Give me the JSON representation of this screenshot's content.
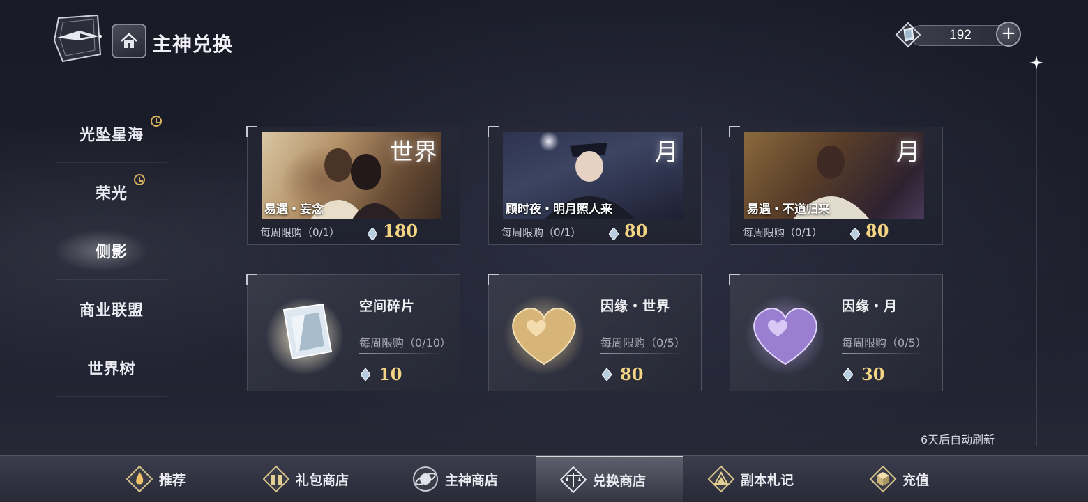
{
  "header": {
    "title": "主神兑换",
    "currency_value": "192",
    "currency_icon": "diamond-gem-icon",
    "add_label": "+"
  },
  "sidebar": {
    "items": [
      {
        "label": "光坠星海",
        "timed": true
      },
      {
        "label": "荣光",
        "timed": true
      },
      {
        "label": "侧影",
        "active": true
      },
      {
        "label": "商业联盟"
      },
      {
        "label": "世界树"
      }
    ]
  },
  "cards_top": [
    {
      "title": "易遇・妄念",
      "mark": "世界",
      "limit": "每周限购（0/1）",
      "price": "180"
    },
    {
      "title": "顾时夜・明月照人来",
      "mark": "月",
      "limit": "每周限购（0/1）",
      "price": "80"
    },
    {
      "title": "易遇・不道归来",
      "mark": "月",
      "limit": "每周限购（0/1）",
      "price": "80"
    }
  ],
  "cards_bottom": [
    {
      "name": "空间碎片",
      "limit": "每周限购（0/10）",
      "price": "10",
      "icon": "space-fragment-icon"
    },
    {
      "name": "因缘・世界",
      "limit": "每周限购（0/5）",
      "price": "80",
      "icon": "gold-heart-icon"
    },
    {
      "name": "因缘・月",
      "limit": "每周限购（0/5）",
      "price": "30",
      "icon": "purple-heart-icon"
    }
  ],
  "refresh_text": "6天后自动刷新",
  "bottom_nav": [
    {
      "label": "推荐",
      "icon": "flame-icon"
    },
    {
      "label": "礼包商店",
      "icon": "gift-icon"
    },
    {
      "label": "主神商店",
      "icon": "planet-icon"
    },
    {
      "label": "兑换商店",
      "icon": "scales-icon",
      "active": true
    },
    {
      "label": "副本札记",
      "icon": "triangle-icon"
    },
    {
      "label": "充值",
      "icon": "cube-icon"
    }
  ],
  "colors": {
    "price_gold": "#f3d583",
    "clock_gold": "#d7b35b",
    "background": "#1c1e2b"
  }
}
